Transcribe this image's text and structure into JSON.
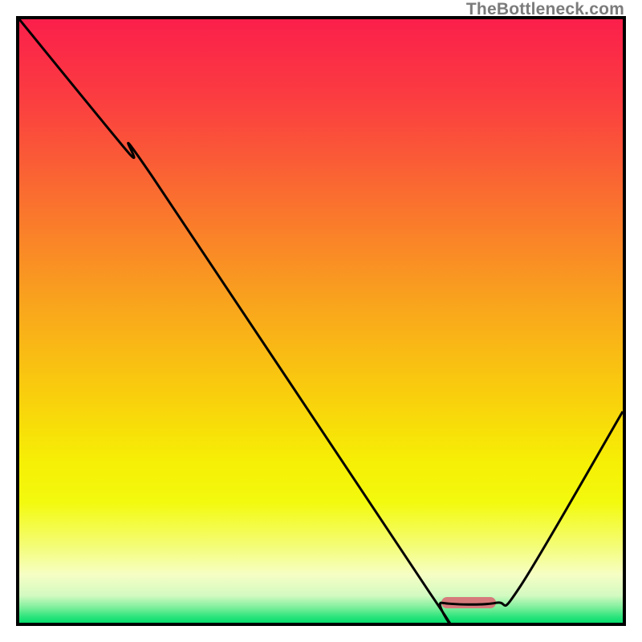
{
  "watermark": "TheBottleneck.com",
  "gradient_stops": [
    {
      "offset": 0.0,
      "color": "#fb1f4b"
    },
    {
      "offset": 0.14,
      "color": "#fb3f40"
    },
    {
      "offset": 0.3,
      "color": "#fa702f"
    },
    {
      "offset": 0.47,
      "color": "#f9a41d"
    },
    {
      "offset": 0.62,
      "color": "#f9ce0d"
    },
    {
      "offset": 0.73,
      "color": "#f6ee05"
    },
    {
      "offset": 0.8,
      "color": "#f3fa0d"
    },
    {
      "offset": 0.87,
      "color": "#f4fd72"
    },
    {
      "offset": 0.92,
      "color": "#f6fec4"
    },
    {
      "offset": 0.955,
      "color": "#d3fac1"
    },
    {
      "offset": 0.975,
      "color": "#7cef9b"
    },
    {
      "offset": 0.99,
      "color": "#2de47c"
    },
    {
      "offset": 1.0,
      "color": "#06de6d"
    }
  ],
  "marker": {
    "x_frac_left": 0.7,
    "x_frac_right": 0.79,
    "y_frac_center": 0.967,
    "color": "#d67a7c"
  },
  "chart_data": {
    "type": "line",
    "title": "",
    "xlabel": "",
    "ylabel": "",
    "xlim": [
      0,
      100
    ],
    "ylim": [
      0,
      100
    ],
    "x": [
      0,
      18,
      22,
      68,
      70,
      79,
      83,
      100
    ],
    "values": [
      100,
      78,
      74,
      5,
      3.3,
      3.3,
      6,
      35
    ],
    "annotations": [
      {
        "text": "TheBottleneck.com",
        "pos": "top-right"
      }
    ],
    "highlight_range_x": [
      70,
      79
    ]
  }
}
